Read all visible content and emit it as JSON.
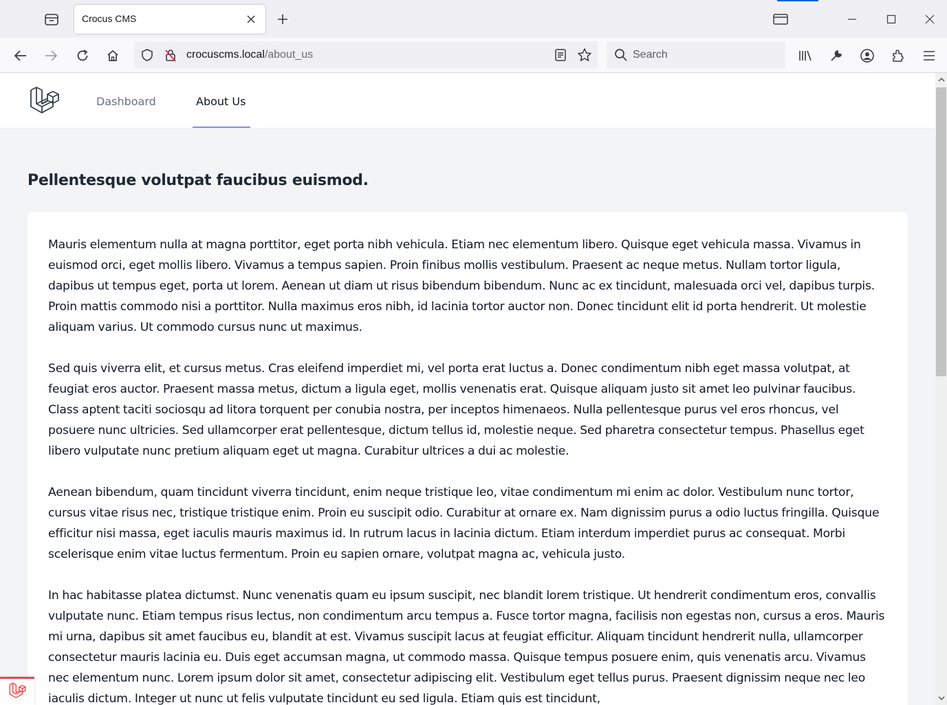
{
  "browser": {
    "tab_title": "Crocus CMS",
    "url_host": "crocuscms.local",
    "url_path": "/about_us",
    "search_placeholder": "Search"
  },
  "app": {
    "nav_links": [
      "Dashboard",
      "About Us"
    ],
    "active_link": "About Us",
    "accent_color": "#818cf8"
  },
  "page": {
    "heading": "Pellentesque volutpat faucibus euismod.",
    "paragraphs": [
      "Mauris elementum nulla at magna porttitor, eget porta nibh vehicula. Etiam nec elementum libero. Quisque eget vehicula massa. Vivamus in euismod orci, eget mollis libero. Vivamus a tempus sapien. Proin finibus mollis vestibulum. Praesent ac neque metus. Nullam tortor ligula, dapibus ut tempus eget, porta ut lorem. Aenean ut diam ut risus bibendum bibendum. Nunc ac ex tincidunt, malesuada orci vel, dapibus turpis. Proin mattis commodo nisi a porttitor. Nulla maximus eros nibh, id lacinia tortor auctor non. Donec tincidunt elit id porta hendrerit. Ut molestie aliquam varius. Ut commodo cursus nunc ut maximus.",
      "Sed quis viverra elit, et cursus metus. Cras eleifend imperdiet mi, vel porta erat luctus a. Donec condimentum nibh eget massa volutpat, at feugiat eros auctor. Praesent massa metus, dictum a ligula eget, mollis venenatis erat. Quisque aliquam justo sit amet leo pulvinar faucibus. Class aptent taciti sociosqu ad litora torquent per conubia nostra, per inceptos himenaeos. Nulla pellentesque purus vel eros rhoncus, vel posuere nunc ultricies. Sed ullamcorper erat pellentesque, dictum tellus id, molestie neque. Sed pharetra consectetur tempus. Phasellus eget libero vulputate nunc pretium aliquam eget ut magna. Curabitur ultrices a dui ac molestie.",
      "Aenean bibendum, quam tincidunt viverra tincidunt, enim neque tristique leo, vitae condimentum mi enim ac dolor. Vestibulum nunc tortor, cursus vitae risus nec, tristique tristique enim. Proin eu suscipit odio. Curabitur at ornare ex. Nam dignissim purus a odio luctus fringilla. Quisque efficitur nisi massa, eget iaculis mauris maximus id. In rutrum lacus in lacinia dictum. Etiam interdum imperdiet purus ac consequat. Morbi scelerisque enim vitae luctus fermentum. Proin eu sapien ornare, volutpat magna ac, vehicula justo.",
      "In hac habitasse platea dictumst. Nunc venenatis quam eu ipsum suscipit, nec blandit lorem tristique. Ut hendrerit condimentum eros, convallis vulputate nunc. Etiam tempus risus lectus, non condimentum arcu tempus a. Fusce tortor magna, facilisis non egestas non, cursus a eros. Mauris mi urna, dapibus sit amet faucibus eu, blandit at est. Vivamus suscipit lacus at feugiat efficitur. Aliquam tincidunt hendrerit nulla, ullamcorper consectetur mauris lacinia eu. Duis eget accumsan magna, ut commodo massa. Quisque tempus posuere enim, quis venenatis arcu. Vivamus nec elementum nunc. Lorem ipsum dolor sit amet, consectetur adipiscing elit. Vestibulum eget tellus purus. Praesent dignissim neque nec leo iaculis dictum. Integer ut nunc ut felis vulputate tincidunt eu sed ligula. Etiam quis est tincidunt,"
    ]
  },
  "icons": [
    "tab-overview-icon",
    "close-icon",
    "plus-icon",
    "window-icon",
    "minimize-icon",
    "maximize-icon",
    "close-window-icon",
    "back-icon",
    "forward-icon",
    "reload-icon",
    "home-icon",
    "shield-icon",
    "insecure-lock-icon",
    "reader-view-icon",
    "bookmark-star-icon",
    "search-icon",
    "library-icon",
    "wrench-icon",
    "account-icon",
    "extensions-icon",
    "menu-icon",
    "laravel-logo-icon"
  ]
}
